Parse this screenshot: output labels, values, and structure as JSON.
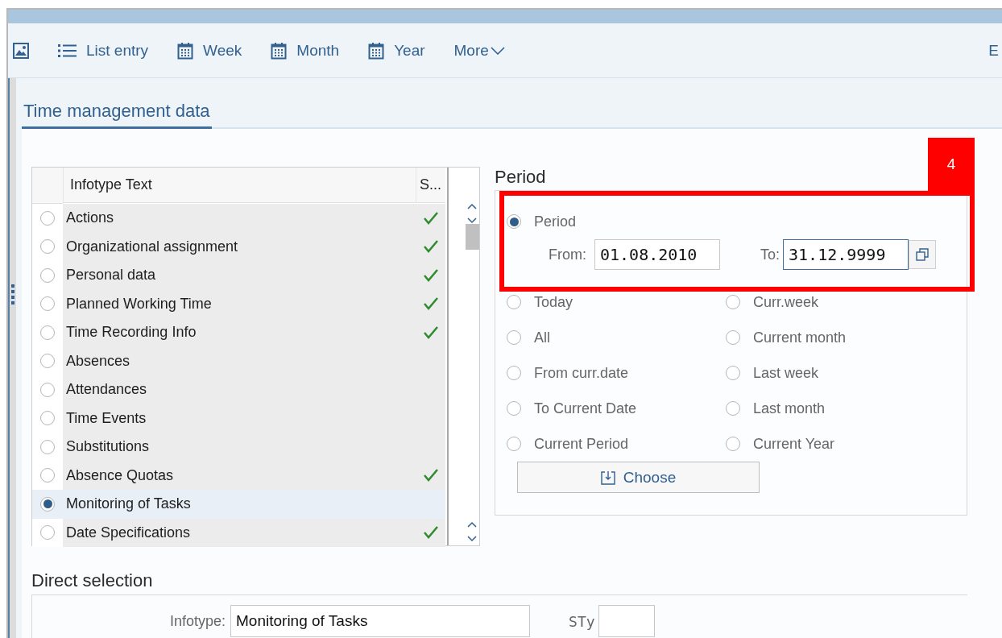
{
  "toolbar": {
    "items": [
      {
        "kind": "image"
      },
      {
        "kind": "list",
        "label": "List entry"
      },
      {
        "kind": "calendar",
        "label": "Week"
      },
      {
        "kind": "calendar",
        "label": "Month"
      },
      {
        "kind": "calendar",
        "label": "Year"
      },
      {
        "kind": "more",
        "label": "More"
      }
    ],
    "cut_item": "E"
  },
  "tab": {
    "label": "Time management data",
    "selected": true
  },
  "infotype_table": {
    "columns": [
      "Infotype Text",
      "S..."
    ],
    "rows": [
      {
        "label": "Actions",
        "selected": false,
        "status_ok": true
      },
      {
        "label": "Organizational assignment",
        "selected": false,
        "status_ok": true
      },
      {
        "label": "Personal data",
        "selected": false,
        "status_ok": true
      },
      {
        "label": "Planned Working Time",
        "selected": false,
        "status_ok": true
      },
      {
        "label": "Time Recording Info",
        "selected": false,
        "status_ok": true
      },
      {
        "label": "Absences",
        "selected": false,
        "status_ok": false
      },
      {
        "label": "Attendances",
        "selected": false,
        "status_ok": false
      },
      {
        "label": "Time Events",
        "selected": false,
        "status_ok": false
      },
      {
        "label": "Substitutions",
        "selected": false,
        "status_ok": false
      },
      {
        "label": "Absence Quotas",
        "selected": false,
        "status_ok": true
      },
      {
        "label": "Monitoring of Tasks",
        "selected": true,
        "status_ok": false
      },
      {
        "label": "Date Specifications",
        "selected": false,
        "status_ok": true
      }
    ]
  },
  "period": {
    "title": "Period",
    "main_option": {
      "label": "Period",
      "selected": true
    },
    "from_label": "From:",
    "from_value": "01.08.2010",
    "to_label": "To:",
    "to_value": "31.12.9999",
    "options": [
      {
        "label": "Today",
        "selected": false
      },
      {
        "label": "Curr.week",
        "selected": false
      },
      {
        "label": "All",
        "selected": false
      },
      {
        "label": "Current month",
        "selected": false
      },
      {
        "label": "From curr.date",
        "selected": false
      },
      {
        "label": "Last week",
        "selected": false
      },
      {
        "label": "To Current Date",
        "selected": false
      },
      {
        "label": "Last month",
        "selected": false
      },
      {
        "label": "Current Period",
        "selected": false
      },
      {
        "label": "Current Year",
        "selected": false
      }
    ],
    "choose_button": "Choose"
  },
  "callout": {
    "number": "4"
  },
  "direct_selection": {
    "title": "Direct selection",
    "infotype_label": "Infotype:",
    "infotype_value": "Monitoring of Tasks",
    "subtype_label": "STy"
  }
}
